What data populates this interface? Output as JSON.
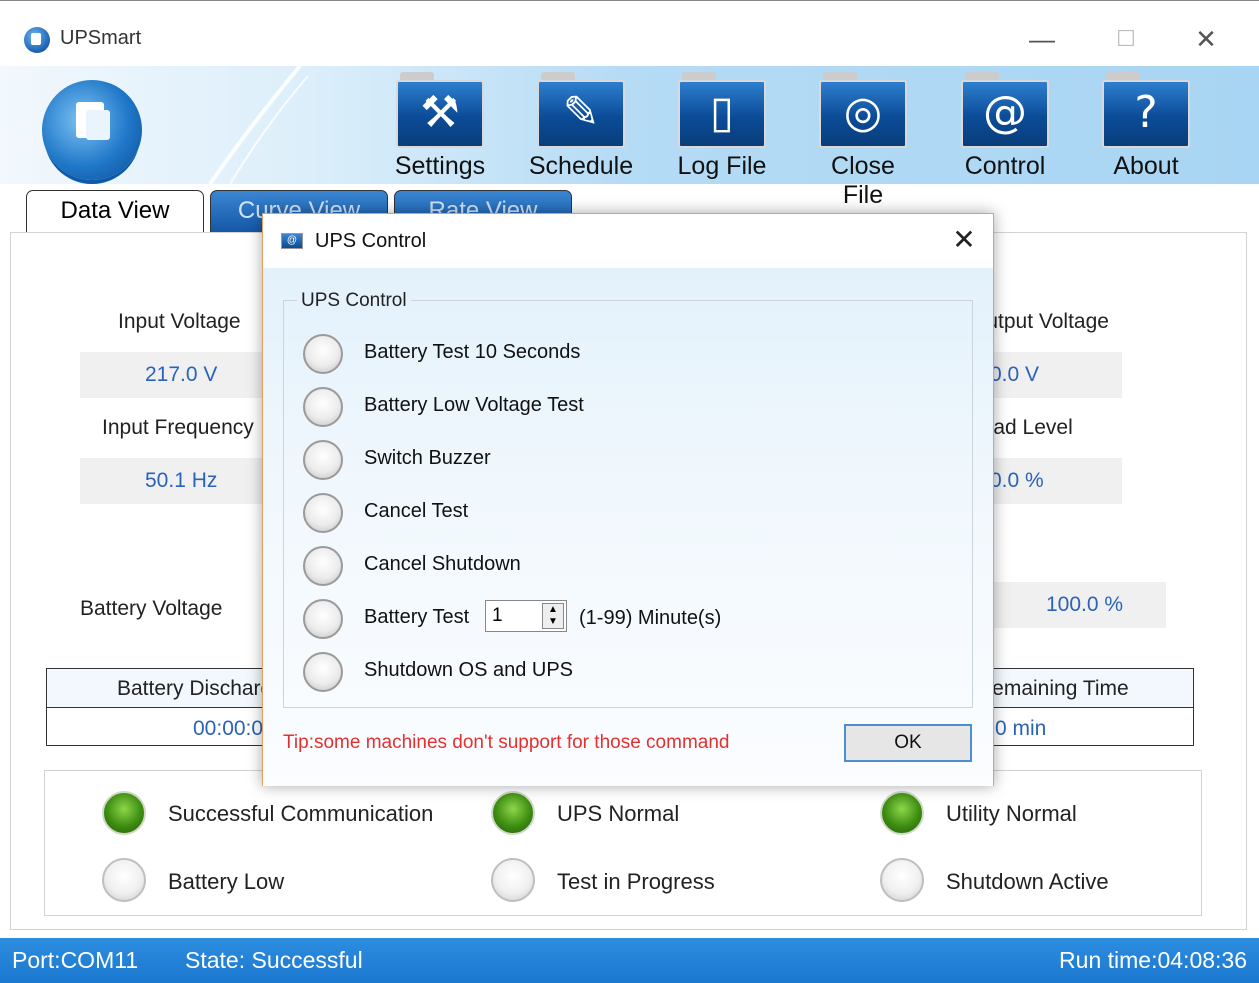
{
  "window": {
    "title": "UPSmart",
    "minimize": "—",
    "maximize": "☐",
    "close": "✕"
  },
  "toolbar": [
    {
      "label": "Settings",
      "icon": "hammer-icon",
      "glyph": "⚒"
    },
    {
      "label": "Schedule",
      "icon": "edit-icon",
      "glyph": "✎"
    },
    {
      "label": "Log File",
      "icon": "document-icon",
      "glyph": "🗋"
    },
    {
      "label": "Close File",
      "icon": "disc-icon",
      "glyph": "◎"
    },
    {
      "label": "Control",
      "icon": "at-icon",
      "glyph": "@"
    },
    {
      "label": "About",
      "icon": "question-icon",
      "glyph": "?"
    }
  ],
  "tabs": [
    "Data View",
    "Curve View",
    "Rate View"
  ],
  "data": {
    "input_voltage_label": "Input Voltage",
    "input_voltage_value": "217.0 V",
    "input_frequency_label": "Input Frequency",
    "input_frequency_value": "50.1 Hz",
    "output_voltage_label": "Output Voltage",
    "output_voltage_value": "0.0 V",
    "load_level_label": "Load Level",
    "load_level_value": "0.0 %",
    "battery_voltage_label": "Battery Voltage",
    "battery_capacity_value": "100.0 %",
    "discharge_header": "Battery Discharge Time",
    "discharge_value": "00:00:00",
    "remaining_header": "Remaining Time",
    "remaining_value": "0 min"
  },
  "status": {
    "successful_communication": "Successful Communication",
    "ups_normal": "UPS Normal",
    "utility_normal": "Utility Normal",
    "battery_low": "Battery Low",
    "test_in_progress": "Test in Progress",
    "shutdown_active": "Shutdown Active"
  },
  "statusbar": {
    "port": "Port:COM11",
    "state": "State: Successful",
    "run_time": "Run time:04:08:36"
  },
  "dialog": {
    "title": "UPS Control",
    "group_label": "UPS Control",
    "options": [
      "Battery Test 10 Seconds",
      "Battery Low Voltage Test",
      "Switch Buzzer",
      "Cancel Test",
      "Cancel Shutdown",
      "Battery Test",
      "Shutdown OS and UPS"
    ],
    "battery_test_minutes": "1",
    "minutes_range": "(1-99) Minute(s)",
    "tip": "Tip:some machines don't support for those command",
    "ok_label": "OK",
    "close": "✕"
  }
}
